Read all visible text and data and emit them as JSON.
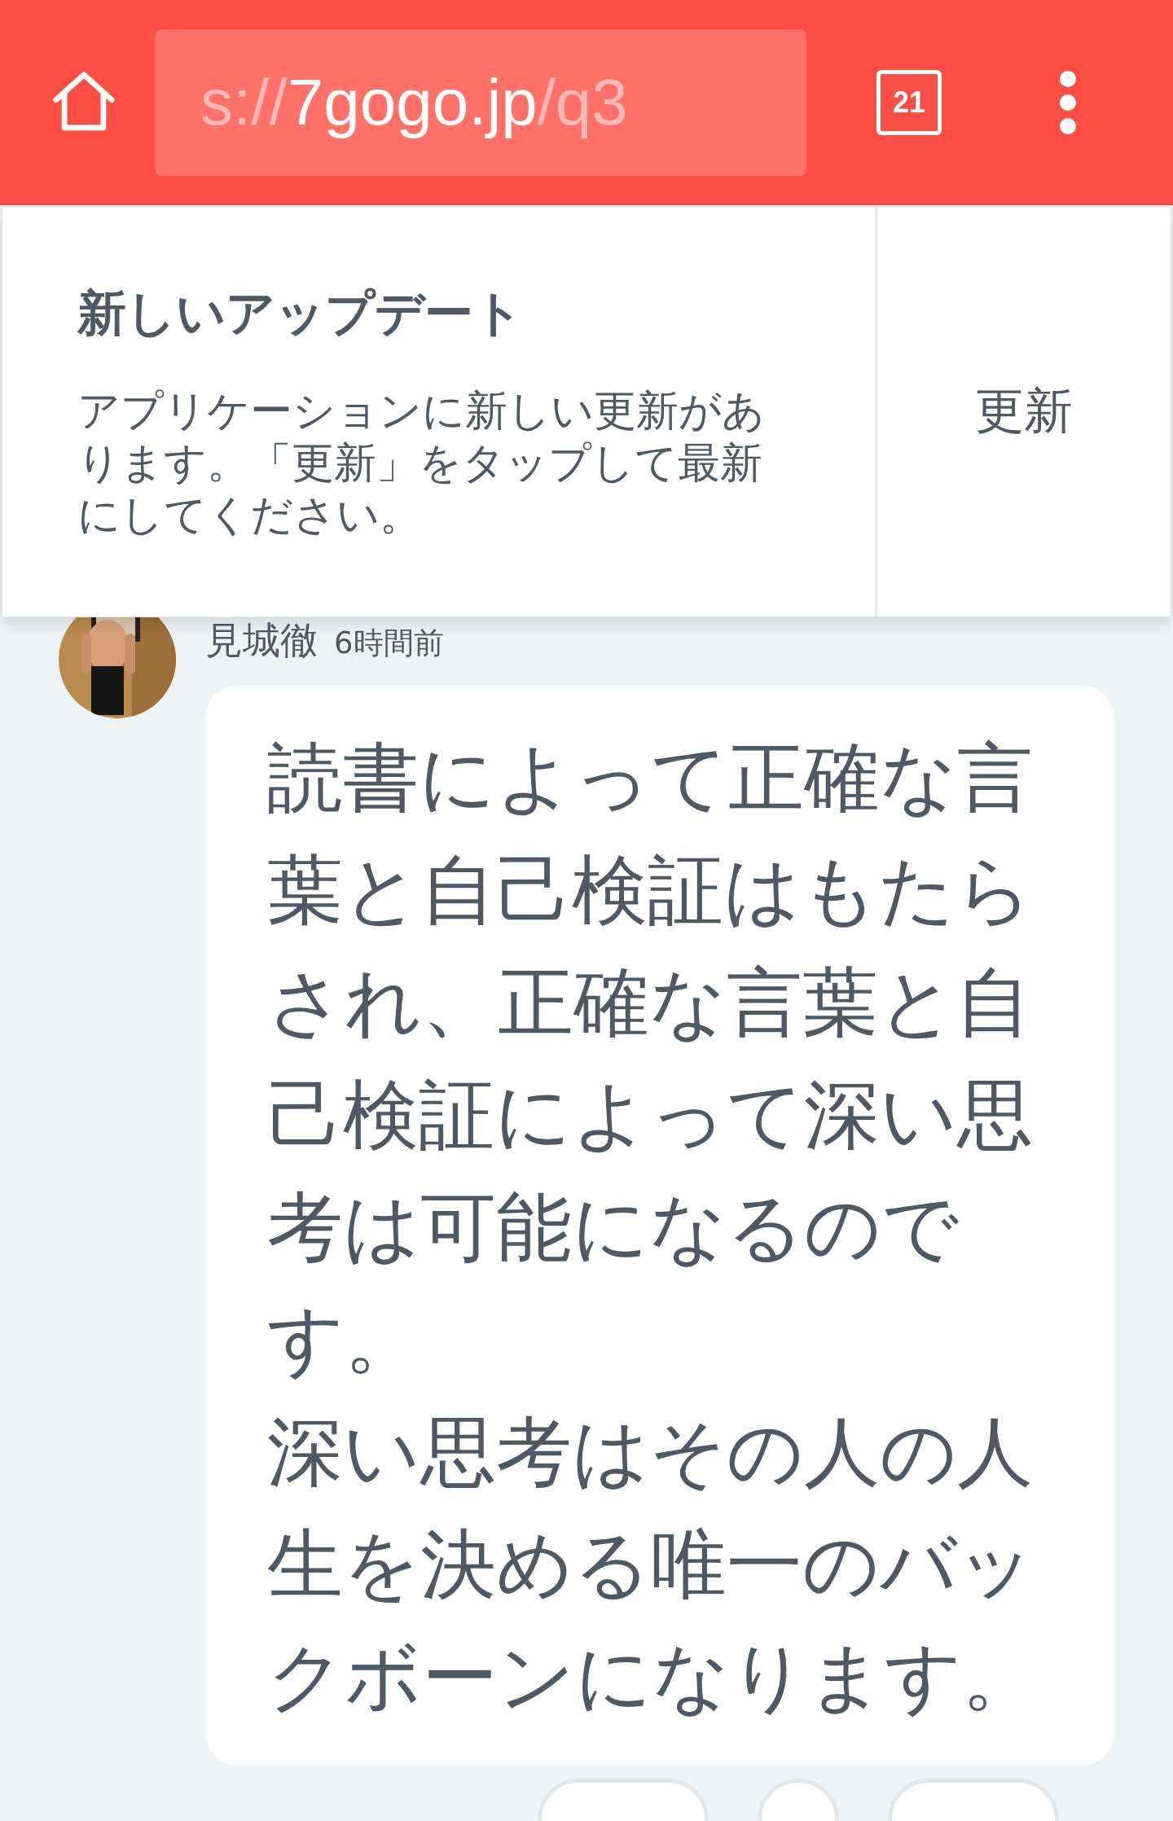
{
  "toolbar": {
    "url": {
      "prefix": "s://",
      "host": "7gogo.jp",
      "suffix": "/q3"
    },
    "tab_count": "21"
  },
  "update_banner": {
    "title": "新しいアップデート",
    "message": "アプリケーションに新しい更新があります。「更新」をタップして最新にしてください。",
    "button": "更新"
  },
  "post": {
    "avatar": {
      "kind": "picture"
    },
    "author": "見城徹",
    "time": "6時間前",
    "paragraphs": [
      "読書によって正確な言葉と自己検証はもたらされ、正確な言葉と自己検証によって深い思考は可能になるのです。",
      "深い思考はその人の人生を決める唯一のバックボーンになります。"
    ]
  },
  "reactions": [
    {
      "kind": "pill"
    },
    {
      "kind": "circle"
    },
    {
      "kind": "pill"
    }
  ]
}
